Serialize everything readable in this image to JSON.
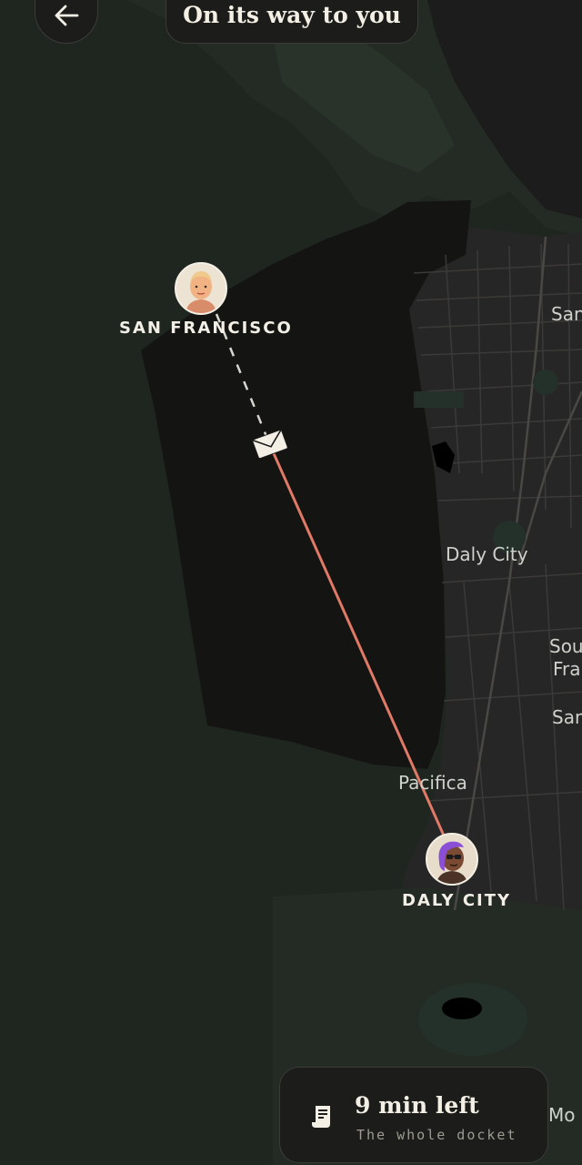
{
  "header": {
    "title": "On its way to you",
    "back_icon": "arrow-left-icon"
  },
  "map": {
    "labels": {
      "san_edge": "San",
      "daly_city": "Daly City",
      "south_sf_line1": "Sou",
      "south_sf_line2": "Fra",
      "san_edge_2": "San",
      "pacifica": "Pacifica",
      "mo_edge": "Mo"
    },
    "colors": {
      "ocean": "#1f2620",
      "land": "#252423",
      "route_remaining": "#e07a67",
      "route_traveled": "#d8d6cf"
    }
  },
  "route": {
    "origin": {
      "name": "SAN FRANCISCO",
      "avatar_icon": "sender-avatar-icon"
    },
    "destination": {
      "name": "DALY CITY",
      "avatar_icon": "recipient-avatar-icon"
    },
    "courier_icon": "envelope-icon"
  },
  "status": {
    "time_left": "9 min left",
    "subtitle": "The whole docket",
    "icon": "receipt-icon"
  }
}
